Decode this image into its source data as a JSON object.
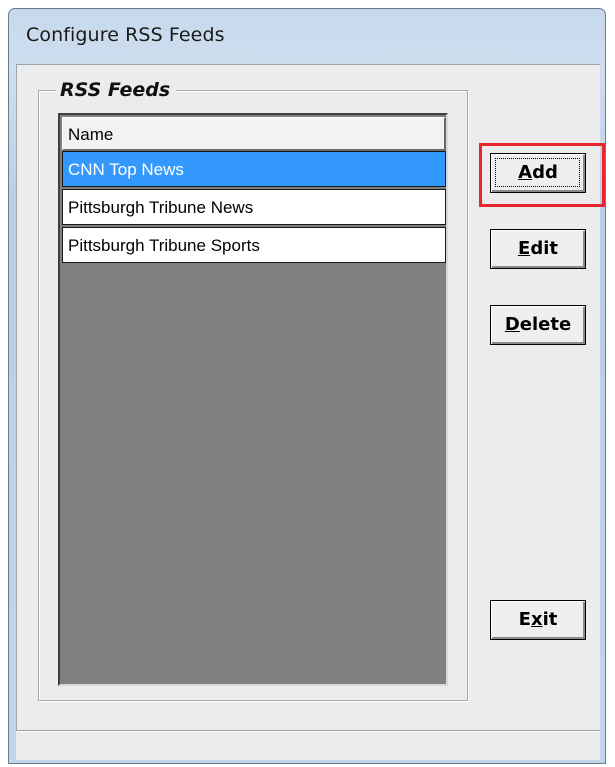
{
  "window": {
    "title": "Configure RSS Feeds"
  },
  "group": {
    "label": "RSS Feeds"
  },
  "list": {
    "columns": [
      "Name"
    ],
    "rows": [
      {
        "name": "CNN Top News",
        "selected": true
      },
      {
        "name": "Pittsburgh Tribune News",
        "selected": false
      },
      {
        "name": "Pittsburgh Tribune Sports",
        "selected": false
      }
    ]
  },
  "buttons": {
    "add": {
      "mnemonic": "A",
      "rest": "dd"
    },
    "edit": {
      "mnemonic": "E",
      "rest": "dit"
    },
    "delete": {
      "mnemonic": "D",
      "rest": "elete"
    },
    "exit": {
      "pre": "E",
      "mnemonic": "x",
      "rest": "it"
    }
  },
  "status": {
    "text": ""
  },
  "colors": {
    "selection": "#3399ff",
    "highlight": "#e8262f",
    "list_background": "#808080"
  }
}
